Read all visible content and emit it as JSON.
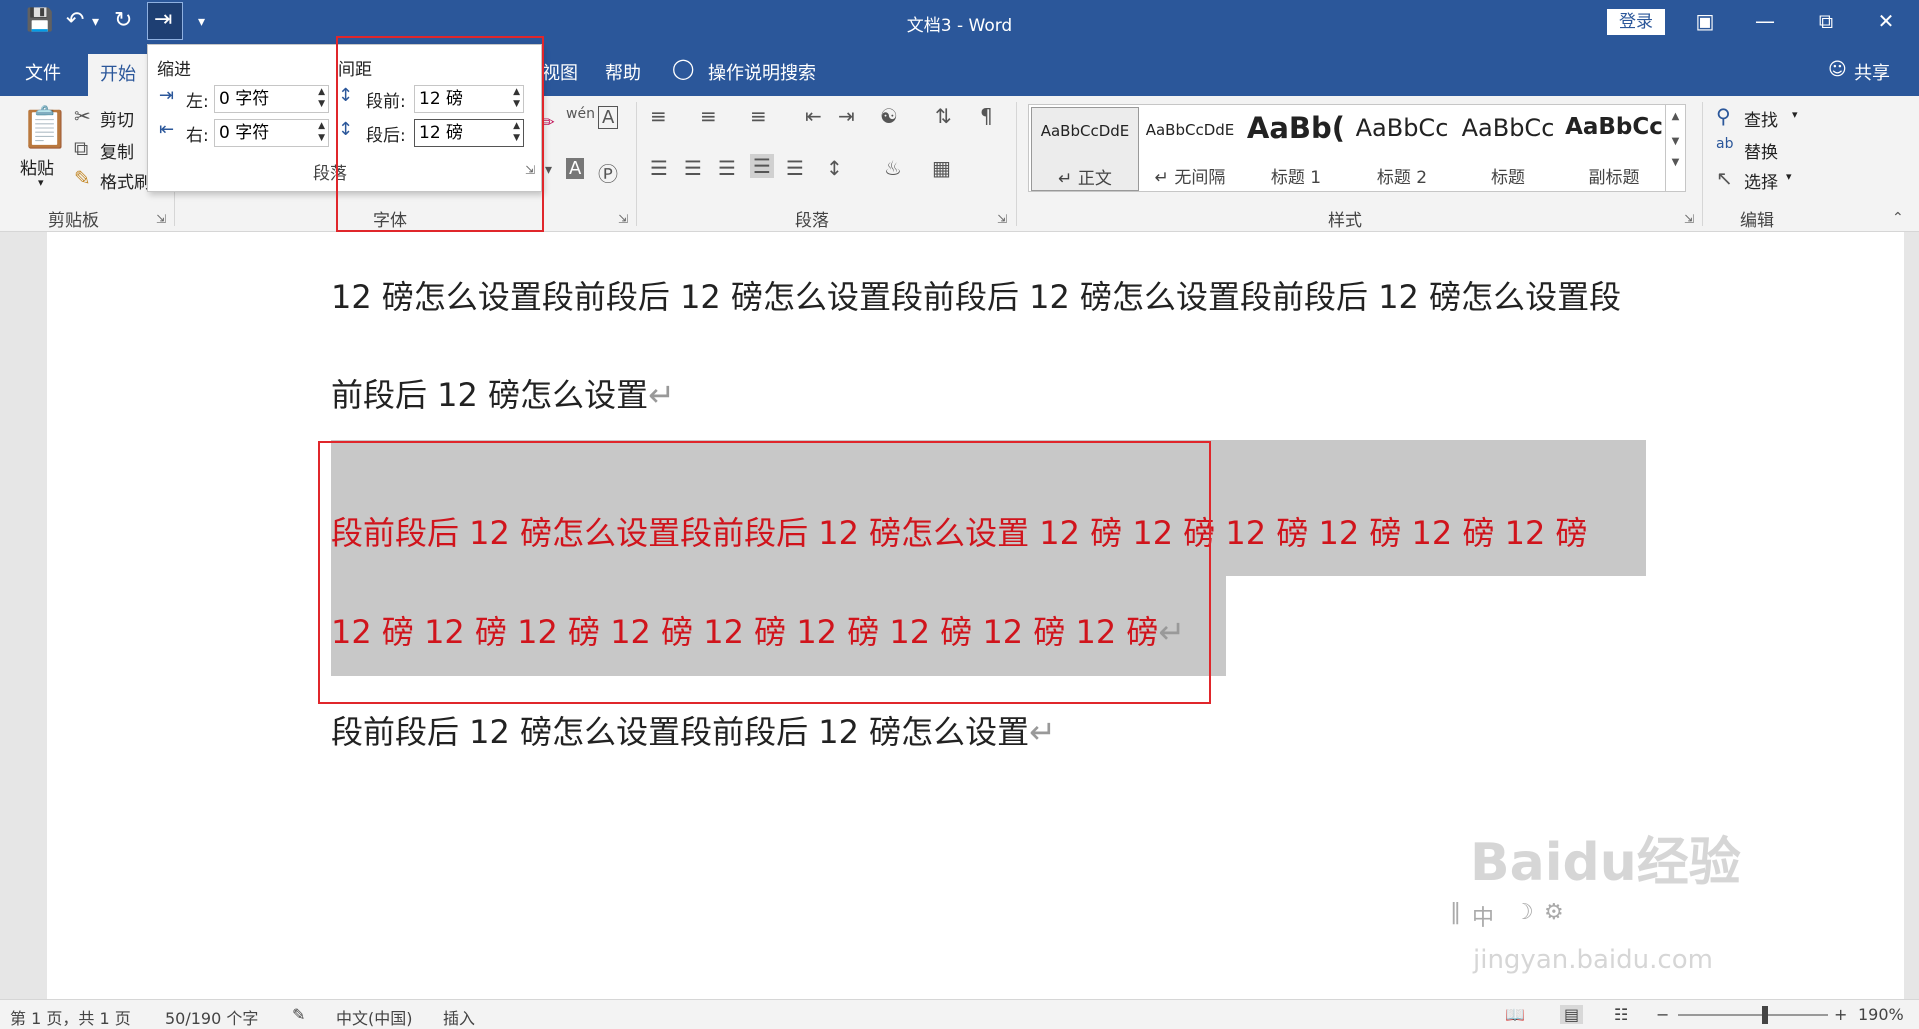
{
  "window": {
    "title": "文档3  -  Word",
    "login": "登录"
  },
  "tabs": [
    "文件",
    "开始",
    "视图",
    "帮助"
  ],
  "search_label": "操作说明搜索",
  "share": "共享",
  "clipboard": {
    "paste": "粘贴",
    "cut": "剪切",
    "copy": "复制",
    "format_painter": "格式刷",
    "group_label": "剪贴板"
  },
  "groups": {
    "font": "字体",
    "paragraph": "段落",
    "styles": "样式",
    "editing": "编辑"
  },
  "styles": [
    {
      "preview": "AaBbCcDdE",
      "name": "↵ 正文"
    },
    {
      "preview": "AaBbCcDdE",
      "name": "↵ 无间隔"
    },
    {
      "preview": "AaBb(",
      "name": "标题 1"
    },
    {
      "preview": "AaBbCc",
      "name": "标题 2"
    },
    {
      "preview": "AaBbCc",
      "name": "标题"
    },
    {
      "preview": "AaBbCc",
      "name": "副标题"
    }
  ],
  "editing": {
    "find": "查找",
    "replace": "替换",
    "select": "选择"
  },
  "panel": {
    "indent_title": "缩进",
    "left_label": "左:",
    "left_value": "0 字符",
    "right_label": "右:",
    "right_value": "0 字符",
    "spacing_title": "间距",
    "before_label": "段前:",
    "before_value": "12 磅",
    "after_label": "段后:",
    "after_value": "12 磅",
    "group_label": "段落"
  },
  "document": {
    "line1": "12 磅怎么设置段前段后 12 磅怎么设置段前段后 12 磅怎么设置段前段后 12 磅怎么设置段",
    "line2": "前段后 12 磅怎么设置",
    "line3": "段前段后 12 磅怎么设置段前段后 12 磅怎么设置 12  磅 12  磅 12  磅 12  磅 12  磅 12  磅",
    "line4": "12  磅 12  磅 12  磅 12  磅 12  磅 12  磅 12  磅 12  磅 12  磅",
    "line5": "段前段后 12 磅怎么设置段前段后 12 磅怎么设置",
    "paragraph_mark": "↵"
  },
  "float_toolbar": "中",
  "status": {
    "page": "第 1 页，共 1 页",
    "words": "50/190 个字",
    "language": "中文(中国)",
    "mode": "插入",
    "zoom": "190%"
  },
  "watermark": {
    "brand": "Baidu经验",
    "url": "jingyan.baidu.com"
  },
  "colors": {
    "title_blue": "#2b579a",
    "highlight_red": "#e0262b",
    "selected_text": "#d0141c",
    "selection_gray": "#c8c8c8"
  }
}
